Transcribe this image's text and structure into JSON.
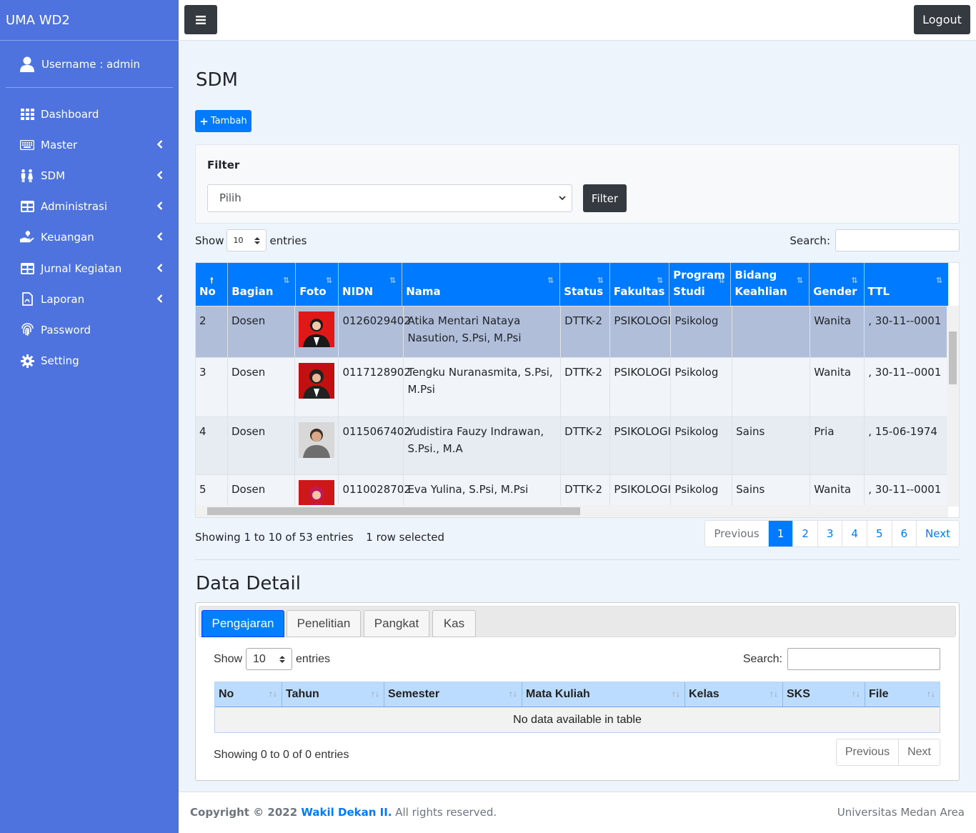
{
  "app": {
    "brand": "UMA WD2",
    "username_label": "Username : admin"
  },
  "topbar": {
    "logout_label": "Logout"
  },
  "sidebar": {
    "items": [
      {
        "label": "Dashboard",
        "icon": "grid-icon",
        "has_submenu": false
      },
      {
        "label": "Master",
        "icon": "keyboard-icon",
        "has_submenu": true
      },
      {
        "label": "SDM",
        "icon": "people-icon",
        "has_submenu": true
      },
      {
        "label": "Administrasi",
        "icon": "table-icon",
        "has_submenu": true
      },
      {
        "label": "Keuangan",
        "icon": "hand-holding-icon",
        "has_submenu": true
      },
      {
        "label": "Jurnal Kegiatan",
        "icon": "table-icon",
        "has_submenu": true
      },
      {
        "label": "Laporan",
        "icon": "pdf-file-icon",
        "has_submenu": true
      },
      {
        "label": "Password",
        "icon": "fingerprint-icon",
        "has_submenu": false
      },
      {
        "label": "Setting",
        "icon": "gear-icon",
        "has_submenu": false
      }
    ]
  },
  "page": {
    "title": "SDM",
    "add_label": "Tambah",
    "filter": {
      "label": "Filter",
      "select_value": "Pilih",
      "button_label": "Filter"
    },
    "show_label": "Show",
    "entries_label": "entries",
    "length_value": "10",
    "search_label": "Search:",
    "table": {
      "columns": [
        {
          "label": "No"
        },
        {
          "label": "Bagian"
        },
        {
          "label": "Foto"
        },
        {
          "label": "NIDN"
        },
        {
          "label": "Nama"
        },
        {
          "label": "Status"
        },
        {
          "label": "Fakultas"
        },
        {
          "label": "Program Studi"
        },
        {
          "label": "Bidang Keahlian"
        },
        {
          "label": "Gender"
        },
        {
          "label": "TTL"
        }
      ],
      "rows": [
        {
          "no": "2",
          "bagian": "Dosen",
          "nidn": "0126029402",
          "nama": "Atika Mentari Nataya Nasution, S.Psi, M.Psi",
          "status": "DTTK-2",
          "fakultas": "PSIKOLOGI",
          "prodi": "Psikolog",
          "bidang": "",
          "gender": "Wanita",
          "ttl": ", 30-11--0001",
          "selected": true,
          "photo_bg": "#e01818",
          "photo_figure": "#1a1a1a"
        },
        {
          "no": "3",
          "bagian": "Dosen",
          "nidn": "0117128902",
          "nama": "Tengku Nuranasmita, S.Psi, M.Psi",
          "status": "DTTK-2",
          "fakultas": "PSIKOLOGI",
          "prodi": "Psikolog",
          "bidang": "",
          "gender": "Wanita",
          "ttl": ", 30-11--0001",
          "selected": false,
          "photo_bg": "#c01010",
          "photo_figure": "#222222"
        },
        {
          "no": "4",
          "bagian": "Dosen",
          "nidn": "0115067402",
          "nama": "Yudistira Fauzy Indrawan, S.Psi., M.A",
          "status": "DTTK-2",
          "fakultas": "PSIKOLOGI",
          "prodi": "Psikolog",
          "bidang": "Sains",
          "gender": "Pria",
          "ttl": ", 15-06-1974",
          "selected": false,
          "photo_bg": "#d8d8d8",
          "photo_figure": "#6e6e6e"
        },
        {
          "no": "5",
          "bagian": "Dosen",
          "nidn": "0110028702",
          "nama": "Eva Yulina, S.Psi, M.Psi",
          "status": "DTTK-2",
          "fakultas": "PSIKOLOGI",
          "prodi": "Psikolog",
          "bidang": "Sains",
          "gender": "Wanita",
          "ttl": ", 30-11--0001",
          "selected": false,
          "photo_bg": "#cc1818",
          "photo_figure": "#c2185b"
        }
      ]
    },
    "info": "Showing 1 to 10 of 53 entries",
    "selected_info": "1 row selected",
    "pagination": [
      "Previous",
      "1",
      "2",
      "3",
      "4",
      "5",
      "6",
      "Next"
    ],
    "active_page": "1"
  },
  "detail": {
    "title": "Data Detail",
    "tabs": [
      "Pengajaran",
      "Penelitian",
      "Pangkat",
      "Kas"
    ],
    "active_tab": "Pengajaran",
    "show_label": "Show",
    "length_value": "10",
    "entries_label": "entries",
    "search_label": "Search:",
    "columns": [
      "No",
      "Tahun",
      "Semester",
      "Mata Kuliah",
      "Kelas",
      "SKS",
      "File"
    ],
    "empty_text": "No data available in table",
    "info": "Showing 0 to 0 of 0 entries",
    "pagination": [
      "Previous",
      "Next"
    ]
  },
  "footer": {
    "copyright_prefix": "Copyright © 2022 ",
    "brand_link": "Wakil Dekan II.",
    "rights": " All rights reserved.",
    "right_text": "Universitas Medan Area"
  },
  "colors": {
    "sidebar": "#4e73df",
    "primary": "#007bff",
    "dark": "#343a40",
    "selected_row": "#b0bed9"
  }
}
